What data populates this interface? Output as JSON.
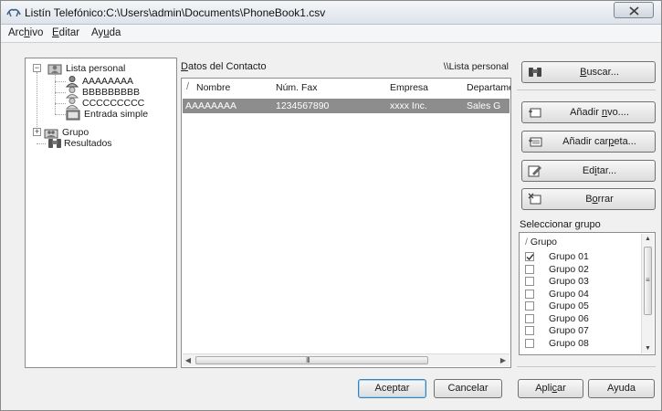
{
  "window": {
    "title": "Listín Telefónico:C:\\Users\\admin\\Documents\\PhoneBook1.csv"
  },
  "menu": [
    {
      "pre": "Arc",
      "key": "h",
      "post": "ivo"
    },
    {
      "pre": "",
      "key": "E",
      "post": "ditar"
    },
    {
      "pre": "Ay",
      "key": "u",
      "post": "da"
    }
  ],
  "tree": {
    "root": "Lista personal",
    "children": [
      "AAAAAAAA",
      "BBBBBBBBB",
      "CCCCCCCCC",
      "Entrada simple"
    ],
    "group": "Grupo",
    "results": "Resultados"
  },
  "contacts": {
    "header_key": "D",
    "header_rest": "atos del Contacto",
    "path": "\\\\Lista personal",
    "columns": [
      "Nombre",
      "Núm. Fax",
      "Empresa",
      "Departame"
    ],
    "rows": [
      {
        "nombre": "AAAAAAAA",
        "fax": "1234567890",
        "empresa": "xxxx Inc.",
        "departamento": "Sales G"
      }
    ],
    "scroll_grip": "III"
  },
  "buttons": {
    "buscar": {
      "key": "B",
      "rest": "uscar..."
    },
    "anadir_nuevo": {
      "pre": "Añadir ",
      "key": "n",
      "post": "vo...."
    },
    "anadir_carpeta": {
      "pre": "Añadir car",
      "key": "p",
      "post": "eta..."
    },
    "editar": {
      "pre": "Ed",
      "key": "i",
      "post": "tar..."
    },
    "borrar": {
      "pre": "B",
      "key": "o",
      "post": "rrar"
    }
  },
  "groups": {
    "caption_pre": "Seleccionar ",
    "caption_key": "g",
    "caption_post": "rupo",
    "header": "Grupo",
    "items": [
      {
        "label": "Grupo 01",
        "checked": true
      },
      {
        "label": "Grupo 02",
        "checked": false
      },
      {
        "label": "Grupo 03",
        "checked": false
      },
      {
        "label": "Grupo 04",
        "checked": false
      },
      {
        "label": "Grupo 05",
        "checked": false
      },
      {
        "label": "Grupo 06",
        "checked": false
      },
      {
        "label": "Grupo 07",
        "checked": false
      },
      {
        "label": "Grupo 08",
        "checked": false
      }
    ],
    "scroll_grip": "≡"
  },
  "footer": {
    "aceptar": "Aceptar",
    "cancelar": "Cancelar",
    "aplicar": {
      "pre": "Apli",
      "key": "c",
      "post": "ar"
    },
    "ayuda": "Ayuda"
  },
  "colors": {
    "selected_row": "#8d8d8d",
    "tree_selection": "#3399ff",
    "window_bg": "#f0f0f0"
  }
}
